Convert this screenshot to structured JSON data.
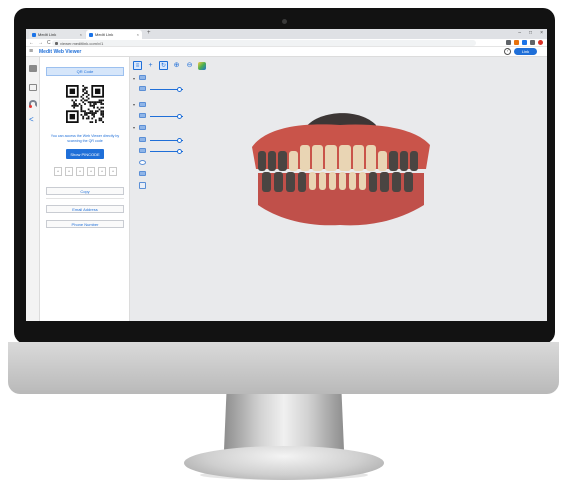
{
  "browser": {
    "tabs": [
      {
        "label": "Medit Link",
        "active": false
      },
      {
        "label": "Medit Link",
        "active": true
      }
    ],
    "new_tab": "+",
    "nav": {
      "back": "←",
      "forward": "→",
      "reload": "C"
    },
    "address": "viewer.meditlink.com/v/1",
    "window_controls": {
      "minimize": "–",
      "maximize": "□",
      "close": "×"
    },
    "extension_colors": [
      "#5f6368",
      "#e8710a",
      "#1a73e8",
      "#5f6368",
      "#d93025"
    ]
  },
  "app": {
    "title": "Medit Web Viewer",
    "menu_icon": "hamburger-icon",
    "help": "?",
    "user_button": "Link"
  },
  "panel": {
    "header": "QR Code",
    "qr_description": "You can access the Web Viewer directly by scanning the QR code",
    "show_pin_button": "Show PINCODE",
    "pin_digits": [
      "*",
      "*",
      "*",
      "*",
      "*",
      "*"
    ],
    "copy_button": "Copy",
    "email_button": "Email Address",
    "phone_button": "Phone Number"
  },
  "rail": {
    "icons": [
      "gallery-icon",
      "notes-icon",
      "support-icon",
      "share-icon"
    ],
    "share_glyph": "<"
  },
  "viewer": {
    "tool_icons": [
      "layers-icon",
      "move-icon",
      "rotate-icon",
      "zoom-in-icon",
      "zoom-out-icon",
      "color-icon"
    ],
    "tool_glyphs": {
      "layers": "≡",
      "move": "+",
      "rotate": "↻",
      "zoom_in": "⊕",
      "zoom_out": "⊖"
    },
    "layer_caret": "▾",
    "opacity_levels": [
      0.45,
      0.45,
      0.45,
      0.45
    ],
    "colors": {
      "accent": "#1f6fd8",
      "gum": "#c9544a",
      "tooth": "#e9d5b4",
      "dark_tooth": "#4a4542",
      "palate": "#3c3635"
    }
  }
}
